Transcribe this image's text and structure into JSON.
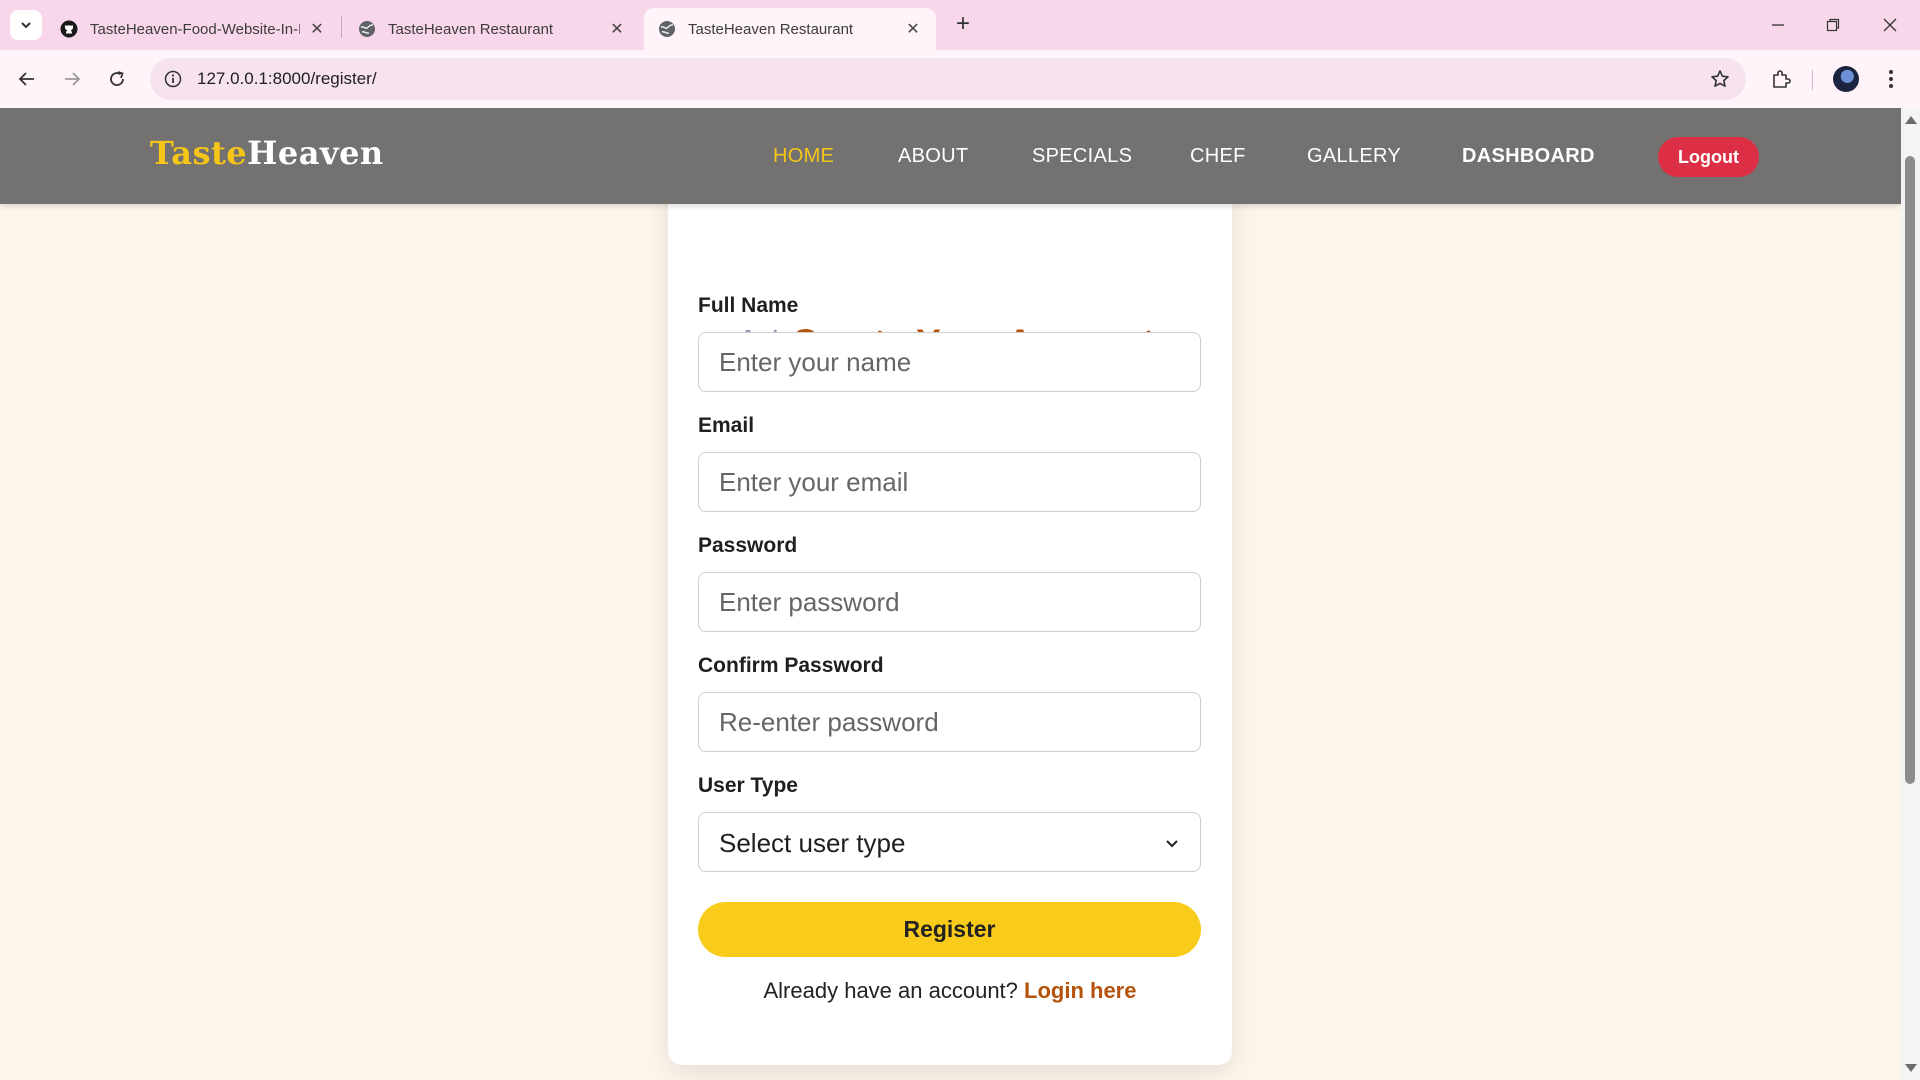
{
  "browser": {
    "tabs": [
      {
        "title": "TasteHeaven-Food-Website-In-D",
        "icon": "github-icon"
      },
      {
        "title": "TasteHeaven Restaurant",
        "icon": "globe-icon"
      },
      {
        "title": "TasteHeaven Restaurant",
        "icon": "globe-icon",
        "active": true
      }
    ],
    "url": "127.0.0.1:8000/register/"
  },
  "site": {
    "logo_part1": "Taste",
    "logo_part2": "Heaven",
    "nav": [
      "HOME",
      "ABOUT",
      "SPECIALS",
      "CHEF",
      "GALLERY",
      "DASHBOARD"
    ],
    "active_nav": "HOME",
    "logout_label": "Logout"
  },
  "form": {
    "title": "Create Your Account",
    "title_icon": "plate-cutlery-icon",
    "full_name_label": "Full Name",
    "full_name_placeholder": "Enter your name",
    "email_label": "Email",
    "email_placeholder": "Enter your email",
    "password_label": "Password",
    "password_placeholder": "Enter password",
    "confirm_label": "Confirm Password",
    "confirm_placeholder": "Re-enter password",
    "user_type_label": "User Type",
    "user_type_value": "Select user type",
    "register_label": "Register",
    "login_prompt": "Already have an account?",
    "login_link": "Login here"
  },
  "colors": {
    "brand_yellow": "#f5c518",
    "accent_brown": "#b5520b",
    "header_gray": "#737270",
    "logout_red": "#dc2f45",
    "button_yellow": "#f9cb1b",
    "page_bg": "#fdf6ec",
    "tabbar_pink": "#f9d7eb"
  }
}
